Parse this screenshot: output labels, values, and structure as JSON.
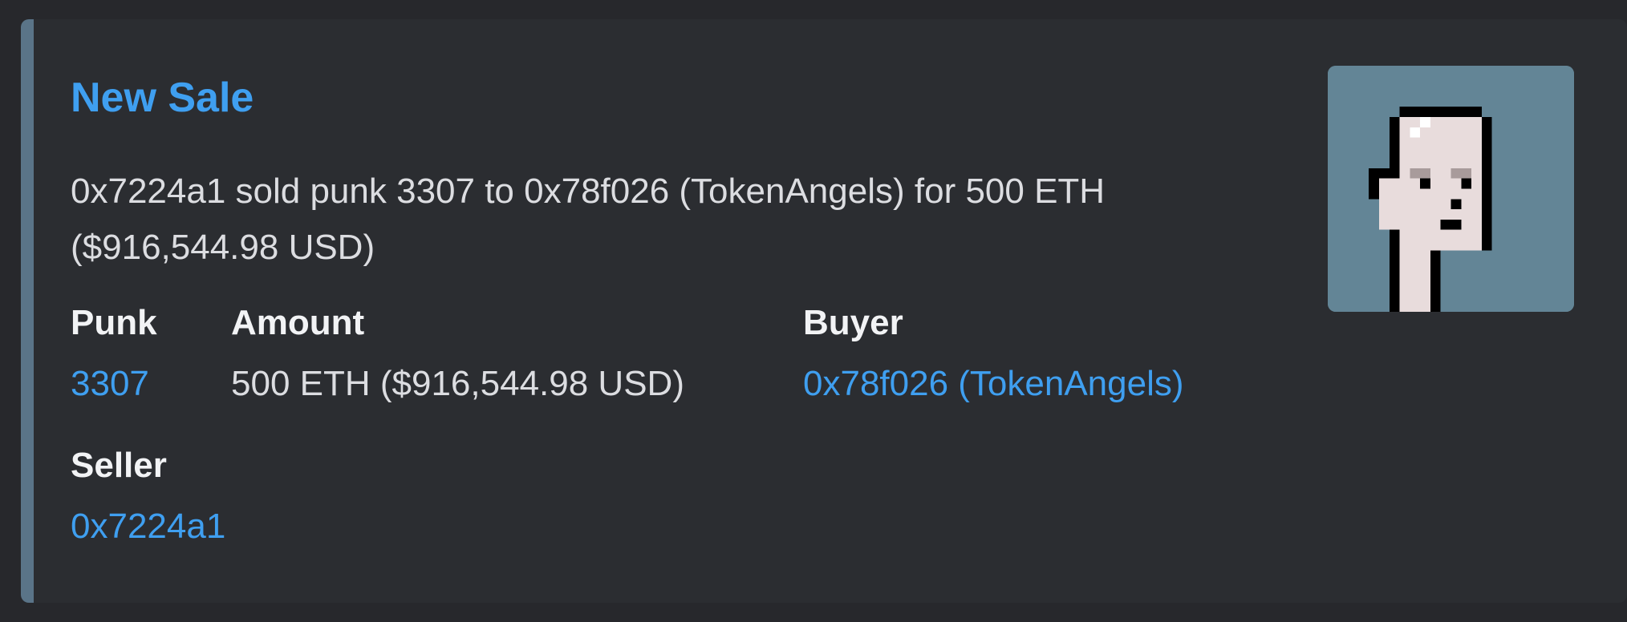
{
  "embed": {
    "accent_color": "#5a7488",
    "title": "New Sale",
    "description_line1": "0x7224a1 sold punk 3307 to 0x78f026 (TokenAngels) for 500 ETH",
    "description_line2": "($916,544.98 USD)",
    "fields": {
      "punk": {
        "name": "Punk",
        "value": "3307"
      },
      "amount": {
        "name": "Amount",
        "value": "500 ETH ($916,544.98 USD)"
      },
      "buyer": {
        "name": "Buyer",
        "value": "0x78f026 (TokenAngels)"
      },
      "seller": {
        "name": "Seller",
        "value": "0x7224a1"
      }
    },
    "thumbnail": {
      "icon": "cryptopunk-avatar-icon",
      "background": "#638596"
    }
  },
  "colors": {
    "link": "#3f9ff0",
    "text": "#dcdde1",
    "background": "#2b2d31"
  }
}
